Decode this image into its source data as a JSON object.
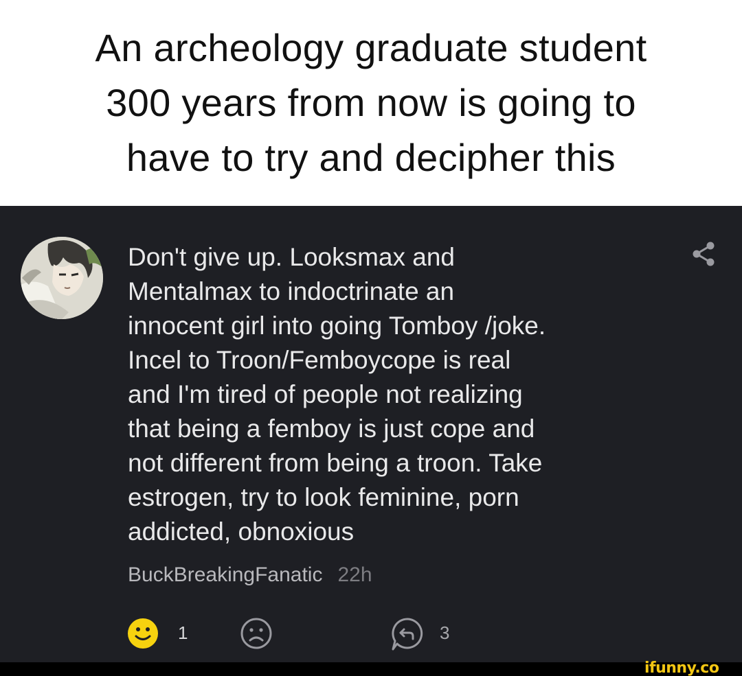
{
  "caption": {
    "lines": [
      "An archeology graduate student",
      "300 years from now is going to",
      "have to try and decipher this"
    ]
  },
  "comment": {
    "avatar_icon": "anime-character-avatar",
    "share_icon": "share-icon",
    "body_lines": [
      "Don't give up. Looksmax and",
      "Mentalmax to indoctrinate an",
      "innocent girl into going Tomboy /joke.",
      "Incel to Troon/Femboycope is real",
      "and I'm tired of people not realizing",
      "that being a femboy is just cope and",
      "not different from being a troon. Take",
      "estrogen, try to look feminine, porn",
      "addicted, obnoxious"
    ],
    "username": "BuckBreakingFanatic",
    "time": "22h",
    "smile_count": "1",
    "reply_count": "3"
  },
  "colors": {
    "panel_bg": "#1e1f24",
    "smile_yellow": "#f6d20f",
    "watermark": "#f3c613"
  },
  "watermark": "ifunny.co"
}
